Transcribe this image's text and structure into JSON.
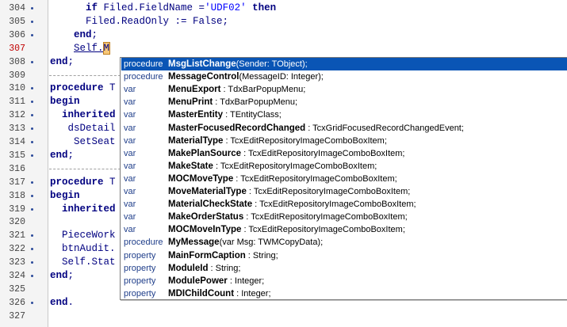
{
  "editor": {
    "lines": [
      {
        "n": "304",
        "dot": true,
        "mod": false,
        "segs": [
          {
            "t": "      "
          },
          {
            "t": "if",
            "c": "kw"
          },
          {
            "t": " Filed.FieldName ="
          },
          {
            "t": "'UDF02'",
            "c": "str"
          },
          {
            "t": " "
          },
          {
            "t": "then",
            "c": "kw"
          }
        ]
      },
      {
        "n": "305",
        "dot": true,
        "mod": false,
        "segs": [
          {
            "t": "      Filed.ReadOnly := False;"
          }
        ]
      },
      {
        "n": "306",
        "dot": true,
        "mod": false,
        "segs": [
          {
            "t": "    "
          },
          {
            "t": "end",
            "c": "kw"
          },
          {
            "t": ";"
          }
        ]
      },
      {
        "n": "307",
        "dot": false,
        "mod": true,
        "segs": [
          {
            "t": "    "
          },
          {
            "t": "Self.",
            "c": "underline"
          },
          {
            "t": "M",
            "c": "cursor-ch"
          }
        ]
      },
      {
        "n": "308",
        "dot": true,
        "mod": false,
        "segs": [
          {
            "t": "end",
            "c": "kw"
          },
          {
            "t": ";"
          }
        ]
      },
      {
        "n": "309",
        "dot": false,
        "mod": false,
        "sep": true,
        "segs": []
      },
      {
        "n": "310",
        "dot": true,
        "mod": false,
        "segs": [
          {
            "t": "procedure",
            "c": "kw"
          },
          {
            "t": " T"
          }
        ]
      },
      {
        "n": "311",
        "dot": true,
        "mod": false,
        "segs": [
          {
            "t": "begin",
            "c": "kw"
          }
        ]
      },
      {
        "n": "312",
        "dot": true,
        "mod": false,
        "segs": [
          {
            "t": "  "
          },
          {
            "t": "inherited",
            "c": "kw"
          }
        ]
      },
      {
        "n": "313",
        "dot": true,
        "mod": false,
        "segs": [
          {
            "t": "   dsDetail"
          }
        ]
      },
      {
        "n": "314",
        "dot": true,
        "mod": false,
        "segs": [
          {
            "t": "    SetSeat"
          }
        ]
      },
      {
        "n": "315",
        "dot": true,
        "mod": false,
        "segs": [
          {
            "t": "end",
            "c": "kw"
          },
          {
            "t": ";"
          }
        ]
      },
      {
        "n": "316",
        "dot": false,
        "mod": false,
        "sep": true,
        "segs": []
      },
      {
        "n": "317",
        "dot": true,
        "mod": false,
        "segs": [
          {
            "t": "procedure",
            "c": "kw"
          },
          {
            "t": " T"
          }
        ]
      },
      {
        "n": "318",
        "dot": true,
        "mod": false,
        "segs": [
          {
            "t": "begin",
            "c": "kw"
          }
        ]
      },
      {
        "n": "319",
        "dot": true,
        "mod": false,
        "segs": [
          {
            "t": "  "
          },
          {
            "t": "inherited",
            "c": "kw"
          }
        ]
      },
      {
        "n": "320",
        "dot": false,
        "mod": false,
        "segs": []
      },
      {
        "n": "321",
        "dot": true,
        "mod": false,
        "segs": [
          {
            "t": "  PieceWork"
          }
        ]
      },
      {
        "n": "322",
        "dot": true,
        "mod": false,
        "segs": [
          {
            "t": "  btnAudit."
          }
        ]
      },
      {
        "n": "323",
        "dot": true,
        "mod": false,
        "segs": [
          {
            "t": "  Self.Stat"
          }
        ]
      },
      {
        "n": "324",
        "dot": true,
        "mod": false,
        "segs": [
          {
            "t": "end",
            "c": "kw"
          },
          {
            "t": ";"
          }
        ]
      },
      {
        "n": "325",
        "dot": false,
        "mod": false,
        "segs": []
      },
      {
        "n": "326",
        "dot": true,
        "mod": false,
        "segs": [
          {
            "t": "end",
            "c": "kw"
          },
          {
            "t": "."
          }
        ]
      },
      {
        "n": "327",
        "dot": false,
        "mod": false,
        "segs": []
      }
    ]
  },
  "completion": {
    "selected_index": 0,
    "items": [
      {
        "kind": "procedure",
        "name": "MsgListChange",
        "sig": "(Sender: TObject);"
      },
      {
        "kind": "procedure",
        "name": "MessageControl",
        "sig": "(MessageID: Integer);"
      },
      {
        "kind": "var",
        "name": "MenuExport",
        "sig": " : TdxBarPopupMenu;"
      },
      {
        "kind": "var",
        "name": "MenuPrint",
        "sig": " : TdxBarPopupMenu;"
      },
      {
        "kind": "var",
        "name": "MasterEntity",
        "sig": " : TEntityClass;"
      },
      {
        "kind": "var",
        "name": "MasterFocusedRecordChanged",
        "sig": " : TcxGridFocusedRecordChangedEvent;"
      },
      {
        "kind": "var",
        "name": "MaterialType",
        "sig": " : TcxEditRepositoryImageComboBoxItem;"
      },
      {
        "kind": "var",
        "name": "MakePlanSource",
        "sig": " : TcxEditRepositoryImageComboBoxItem;"
      },
      {
        "kind": "var",
        "name": "MakeState",
        "sig": " : TcxEditRepositoryImageComboBoxItem;"
      },
      {
        "kind": "var",
        "name": "MOCMoveType",
        "sig": " : TcxEditRepositoryImageComboBoxItem;"
      },
      {
        "kind": "var",
        "name": "MoveMaterialType",
        "sig": " : TcxEditRepositoryImageComboBoxItem;"
      },
      {
        "kind": "var",
        "name": "MaterialCheckState",
        "sig": " : TcxEditRepositoryImageComboBoxItem;"
      },
      {
        "kind": "var",
        "name": "MakeOrderStatus",
        "sig": " : TcxEditRepositoryImageComboBoxItem;"
      },
      {
        "kind": "var",
        "name": "MOCMoveInType",
        "sig": " : TcxEditRepositoryImageComboBoxItem;"
      },
      {
        "kind": "procedure",
        "name": "MyMessage",
        "sig": "(var Msg: TWMCopyData);"
      },
      {
        "kind": "property",
        "name": "MainFormCaption",
        "sig": " : String;"
      },
      {
        "kind": "property",
        "name": "ModuleId",
        "sig": " : String;"
      },
      {
        "kind": "property",
        "name": "ModulePower",
        "sig": " : Integer;"
      },
      {
        "kind": "property",
        "name": "MDIChildCount",
        "sig": " : Integer;"
      }
    ]
  },
  "colors": {
    "selection": "#0a55b5",
    "keyword": "#000080",
    "string": "#0000ff",
    "modified_line_number": "#c00000"
  }
}
